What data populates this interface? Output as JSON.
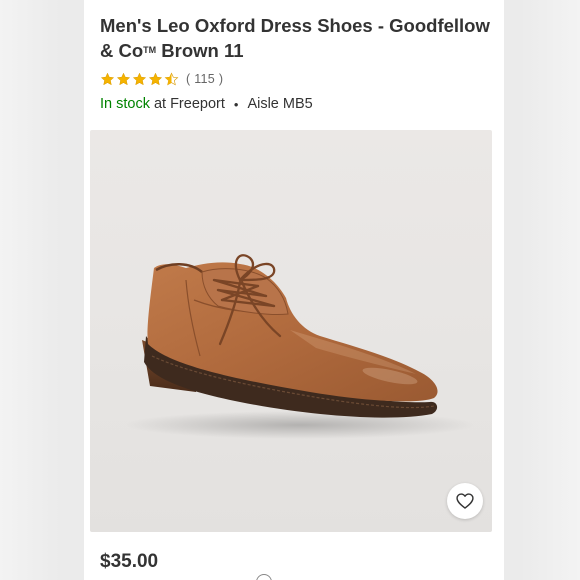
{
  "product": {
    "title_line1": "Men's Leo Oxford Dress Shoes - Goodfellow",
    "title_line2_prefix": "& Co",
    "title_tm": "TM",
    "title_line2_suffix": " Brown 11",
    "rating": {
      "stars": 4.5,
      "count_text": "( 115 )",
      "star_color": "#f5b300"
    },
    "availability": {
      "status": "In stock",
      "at_text": "at",
      "store": "Freeport",
      "separator": "•",
      "aisle": "Aisle MB5"
    },
    "image": {
      "subject": "brown leather oxford dress shoe",
      "favorite_icon": "heart-icon"
    },
    "price": "$35.00"
  },
  "colors": {
    "in_stock": "#008300",
    "text": "#333333",
    "shoe": "#b06a3d"
  }
}
